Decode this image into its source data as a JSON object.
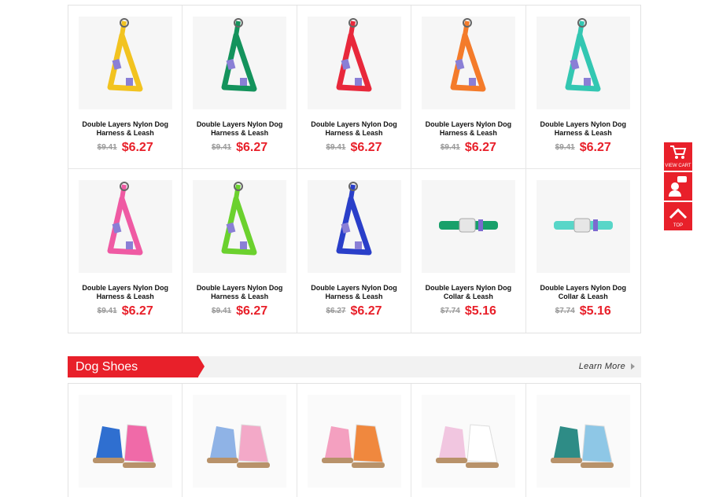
{
  "products": [
    {
      "name": "Double Layers Nylon Dog Harness & Leash",
      "old_price": "$9.41",
      "price": "$6.27",
      "color": "#f2c320",
      "kind": "harness"
    },
    {
      "name": "Double Layers Nylon Dog Harness & Leash",
      "old_price": "$9.41",
      "price": "$6.27",
      "color": "#14935c",
      "kind": "harness"
    },
    {
      "name": "Double Layers Nylon Dog Harness & Leash",
      "old_price": "$9.41",
      "price": "$6.27",
      "color": "#e8283b",
      "kind": "harness"
    },
    {
      "name": "Double Layers Nylon Dog Harness & Leash",
      "old_price": "$9.41",
      "price": "$6.27",
      "color": "#f47b2a",
      "kind": "harness"
    },
    {
      "name": "Double Layers Nylon Dog Harness & Leash",
      "old_price": "$9.41",
      "price": "$6.27",
      "color": "#33c7b2",
      "kind": "harness"
    },
    {
      "name": "Double Layers Nylon Dog Harness & Leash",
      "old_price": "$9.41",
      "price": "$6.27",
      "color": "#ef5aa3",
      "kind": "harness"
    },
    {
      "name": "Double Layers Nylon Dog Harness & Leash",
      "old_price": "$9.41",
      "price": "$6.27",
      "color": "#6bd12e",
      "kind": "harness"
    },
    {
      "name": "Double Layers Nylon Dog Harness & Leash",
      "old_price": "$6.27",
      "price": "$6.27",
      "color": "#2a3fc9",
      "kind": "harness"
    },
    {
      "name": "Double Layers Nylon Dog Collar & Leash",
      "old_price": "$7.74",
      "price": "$5.16",
      "color": "#18a06a",
      "kind": "collar"
    },
    {
      "name": "Double Layers Nylon Dog Collar & Leash",
      "old_price": "$7.74",
      "price": "$5.16",
      "color": "#58d6c8",
      "kind": "collar"
    }
  ],
  "section": {
    "title": "Dog Shoes",
    "learn_more": "Learn More"
  },
  "shoes": [
    {
      "color": "#2f6fd0",
      "accent": "#f06aa8",
      "icon": "shoe-image"
    },
    {
      "color": "#8fb3e6",
      "accent": "#f3a9c8",
      "icon": "shoe-image"
    },
    {
      "color": "#f4a0c0",
      "accent": "#f0883e",
      "icon": "shoe-image"
    },
    {
      "color": "#f1c6e0",
      "accent": "#ffffff",
      "icon": "sneaker-image"
    },
    {
      "color": "#2e8c86",
      "accent": "#8ec7e6",
      "icon": "shoe-image"
    }
  ],
  "float_bar": {
    "view_cart": "VIEW CART",
    "top": "TOP"
  },
  "colors": {
    "accent_red": "#e8202a"
  }
}
